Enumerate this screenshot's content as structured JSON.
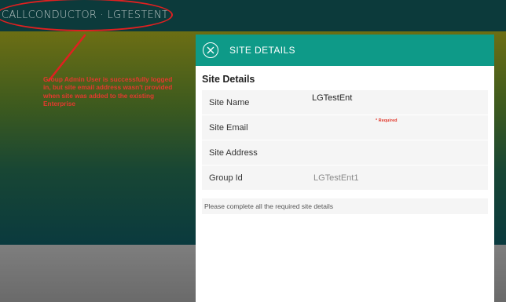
{
  "header": {
    "app_title": "CALLCONDUCTOR  ·  LGTESTENT"
  },
  "annotation": {
    "text": "Group Admin User is successfully logged in, but site email address wasn't provided when site was added to the existing Enterprise",
    "color": "#e23a2e"
  },
  "panel": {
    "title": "SITE DETAILS",
    "close_icon": "close-circle-icon",
    "section_heading": "Site Details",
    "fields": [
      {
        "label": "Site Name",
        "value": "LGTestEnt"
      },
      {
        "label": "Site Email",
        "value": "",
        "required_note": "* Required"
      },
      {
        "label": "Site Address",
        "value": ""
      },
      {
        "label": "Group Id",
        "value": "LGTestEnt1"
      }
    ],
    "status_message": "Please complete all the required site details"
  },
  "colors": {
    "topbar": "#0c3a3b",
    "panel_header": "#0e9a88",
    "annotation_red": "#e23a2e"
  }
}
